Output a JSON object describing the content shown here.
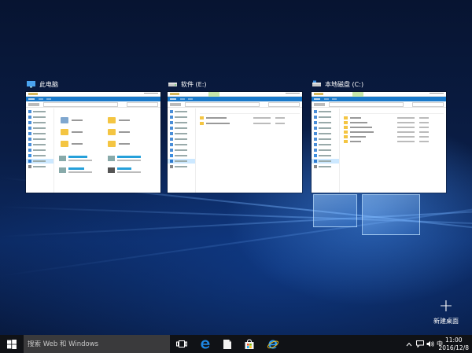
{
  "task_view": {
    "windows": [
      {
        "title": "此电脑",
        "icon": "this-pc-icon"
      },
      {
        "title": "软件 (E:)",
        "icon": "drive-icon"
      },
      {
        "title": "本地磁盘 (C:)",
        "icon": "drive-icon"
      }
    ],
    "new_desktop": {
      "icon": "plus-icon",
      "label": "新建桌面"
    }
  },
  "taskbar": {
    "start_icon": "windows-logo-icon",
    "search": {
      "placeholder": "搜索 Web 和 Windows",
      "value": ""
    },
    "pinned": [
      {
        "name": "task-view-icon"
      },
      {
        "name": "edge-icon"
      },
      {
        "name": "file-explorer-icon"
      },
      {
        "name": "store-icon"
      },
      {
        "name": "internet-explorer-icon"
      }
    ],
    "tray": {
      "chevron_icon": "chevron-up-icon",
      "notification_icon": "action-center-icon",
      "volume_icon": "speaker-icon",
      "ime_label": "中",
      "time": "11:00",
      "date": "2016/12/8"
    }
  }
}
